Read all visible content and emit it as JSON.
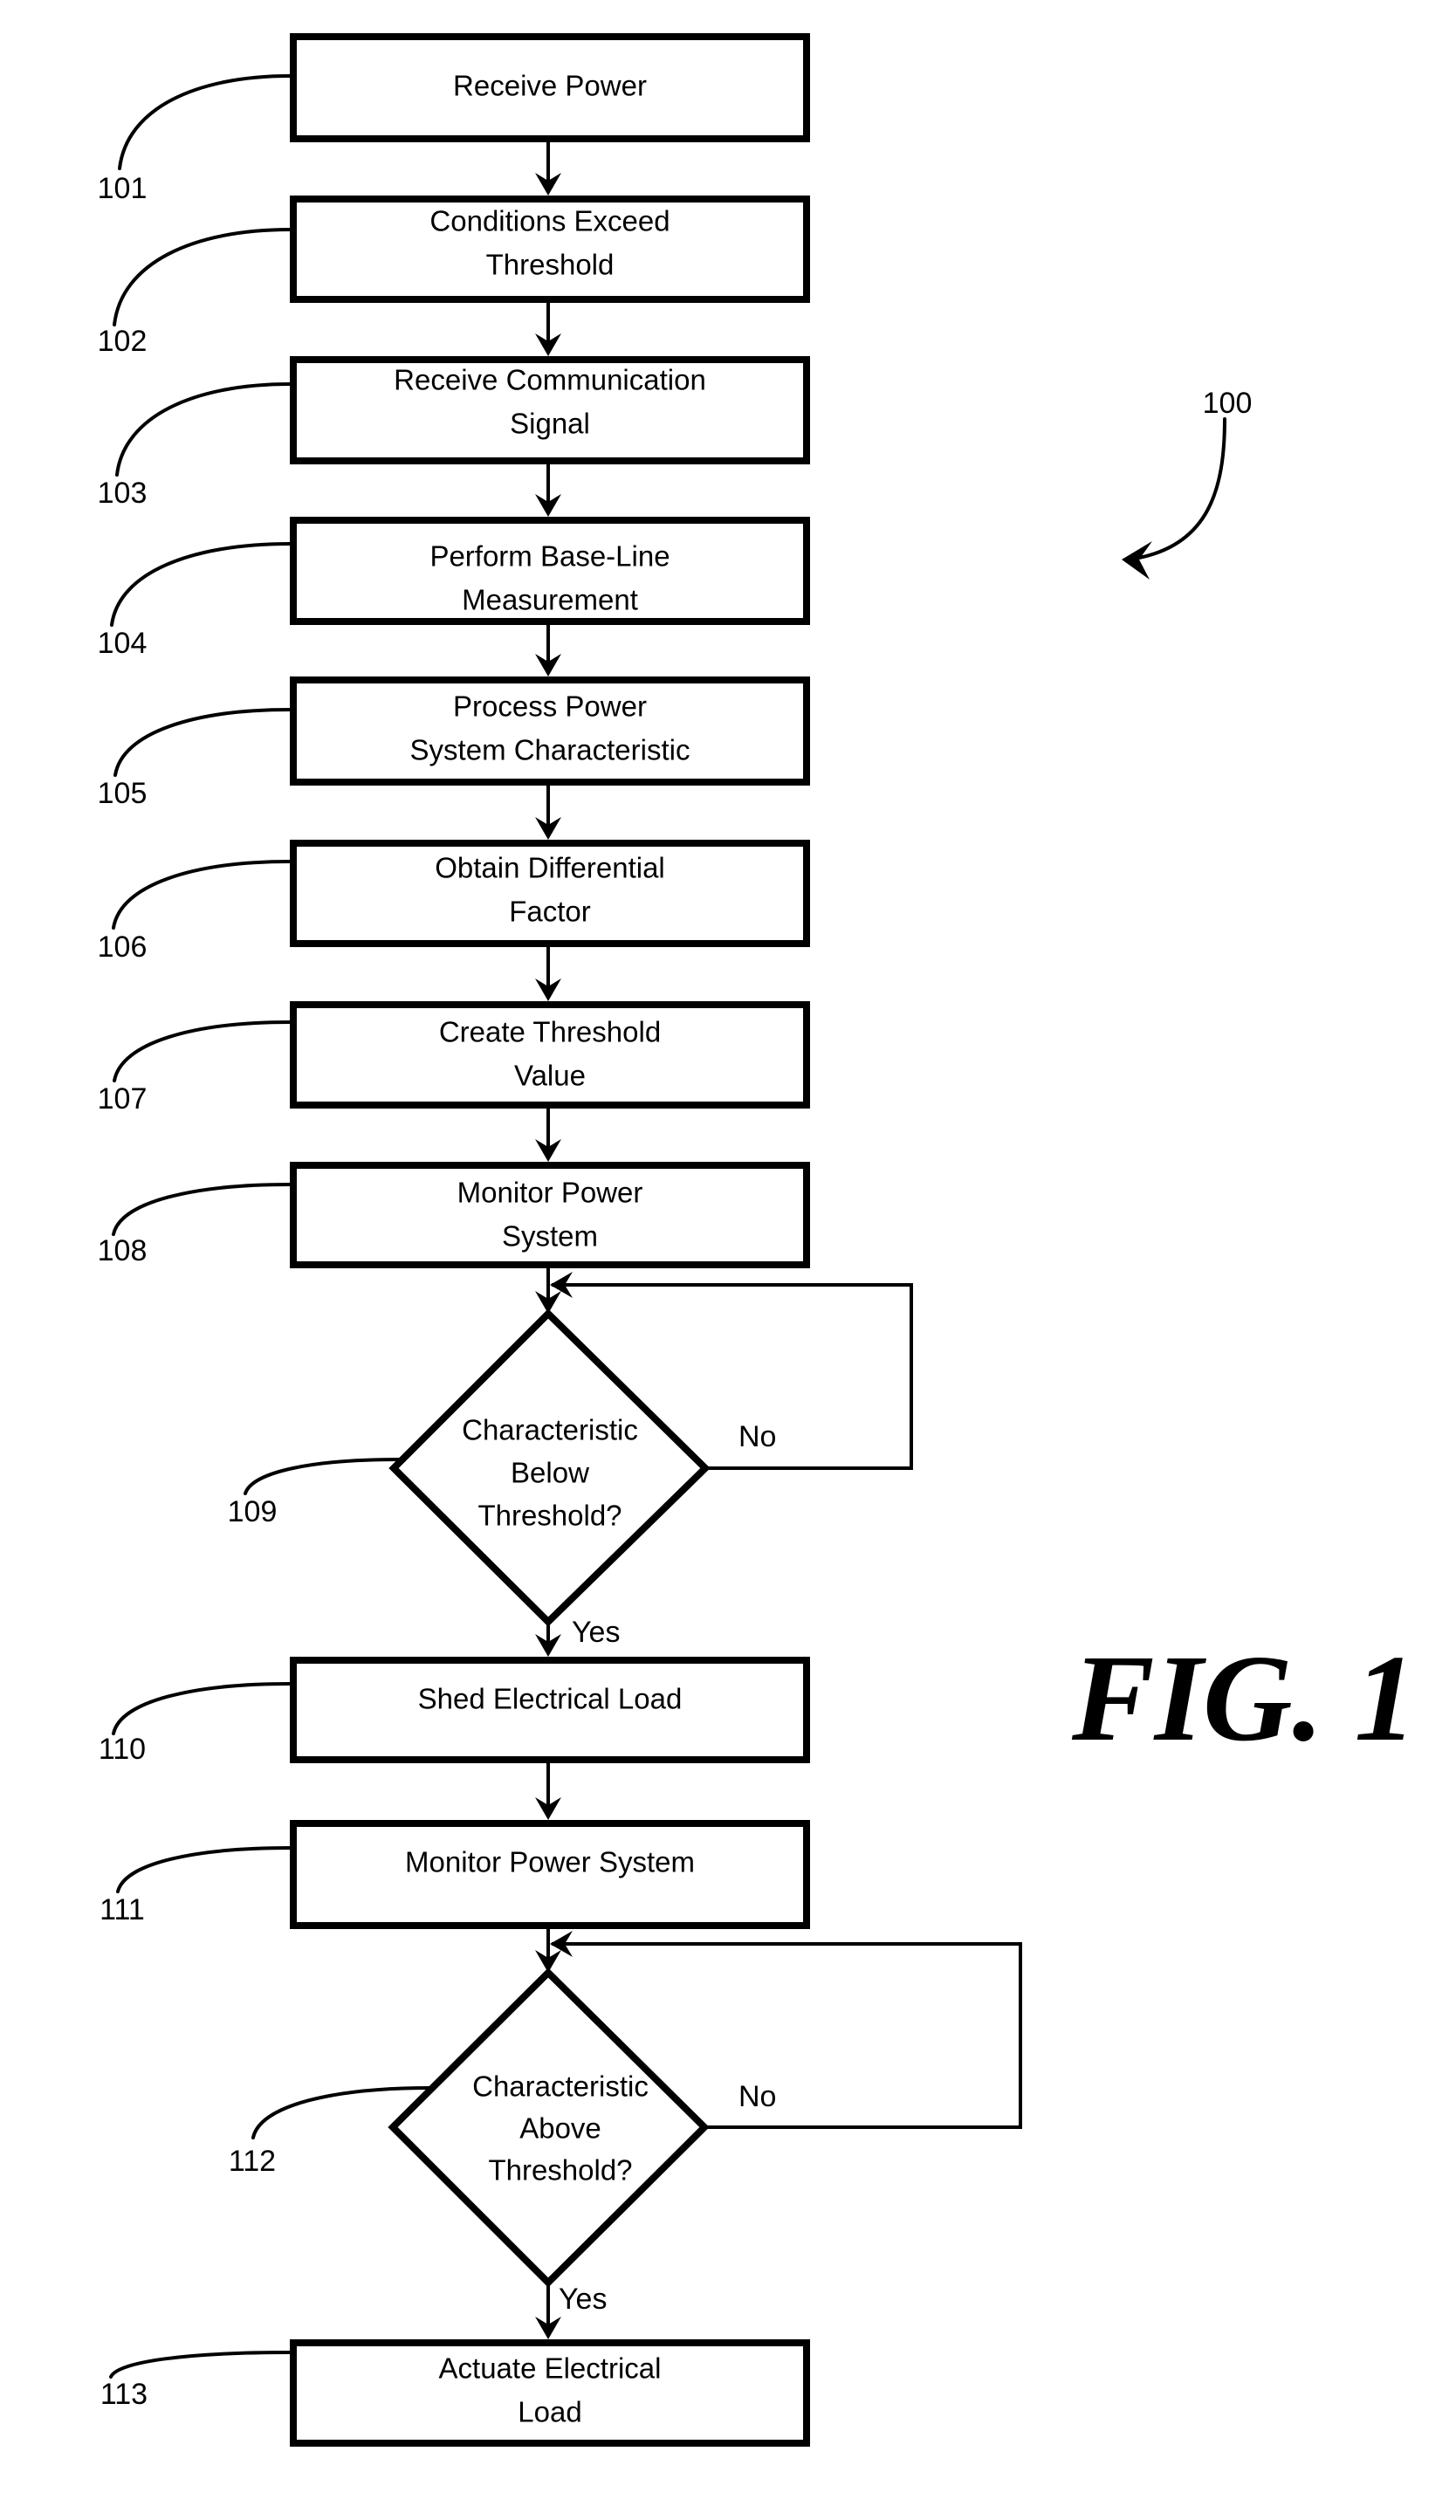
{
  "figure": {
    "label": "FIG. 1",
    "reference": "100",
    "ink_color": "#000000",
    "background_color": "#ffffff"
  },
  "steps": [
    {
      "ref": "101",
      "type": "process",
      "lines": [
        "Receive Power"
      ]
    },
    {
      "ref": "102",
      "type": "process",
      "lines": [
        "Conditions Exceed",
        "Threshold"
      ]
    },
    {
      "ref": "103",
      "type": "process",
      "lines": [
        "Receive Communication",
        "Signal"
      ]
    },
    {
      "ref": "104",
      "type": "process",
      "lines": [
        "Perform Base-Line",
        "Measurement"
      ]
    },
    {
      "ref": "105",
      "type": "process",
      "lines": [
        "Process Power",
        "System Characteristic"
      ]
    },
    {
      "ref": "106",
      "type": "process",
      "lines": [
        "Obtain Differential",
        "Factor"
      ]
    },
    {
      "ref": "107",
      "type": "process",
      "lines": [
        "Create Threshold",
        "Value"
      ]
    },
    {
      "ref": "108",
      "type": "process",
      "lines": [
        "Monitor Power",
        "System"
      ]
    },
    {
      "ref": "109",
      "type": "decision",
      "lines": [
        "Characteristic",
        "Below",
        "Threshold?"
      ],
      "no_label": "No",
      "yes_label": "Yes"
    },
    {
      "ref": "110",
      "type": "process",
      "lines": [
        "Shed Electrical Load"
      ]
    },
    {
      "ref": "111",
      "type": "process",
      "lines": [
        "Monitor Power System"
      ]
    },
    {
      "ref": "112",
      "type": "decision",
      "lines": [
        "Characteristic",
        "Above",
        "Threshold?"
      ],
      "no_label": "No",
      "yes_label": "Yes"
    },
    {
      "ref": "113",
      "type": "process",
      "lines": [
        "Actuate Electrical",
        "Load"
      ]
    }
  ]
}
